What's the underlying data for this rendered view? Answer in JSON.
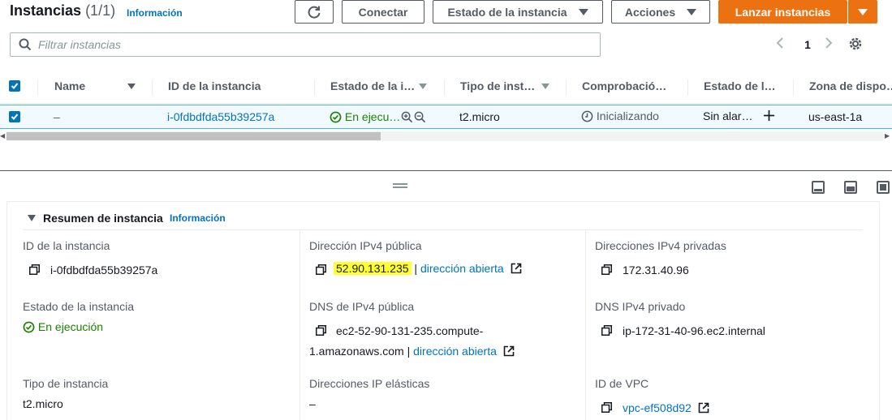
{
  "header": {
    "title": "Instancias",
    "count": "(1/1)",
    "info_link": "Información",
    "buttons": {
      "connect": "Conectar",
      "instance_state": "Estado de la instancia",
      "actions": "Acciones",
      "launch": "Lanzar instancias"
    }
  },
  "search": {
    "placeholder": "Filtrar instancias"
  },
  "pagination": {
    "current_page": "1"
  },
  "table": {
    "columns": [
      "Name",
      "ID de la instancia",
      "Estado de la i…",
      "Tipo de inst…",
      "Comprobació…",
      "Estado de l…",
      "Zona de dispo…"
    ],
    "row": {
      "name": "–",
      "instance_id": "i-0fdbdfda55b39257a",
      "state": "En ejecu…",
      "type": "t2.micro",
      "status_check": "Inicializando",
      "alarm_state": "Sin alar…",
      "zone": "us-east-1a"
    }
  },
  "details": {
    "section_title": "Resumen de instancia",
    "info_link": "Información",
    "fields": {
      "instance_id_label": "ID de la instancia",
      "instance_id_value": "i-0fdbdfda55b39257a",
      "public_ipv4_label": "Dirección IPv4 pública",
      "public_ipv4_value": "52.90.131.235",
      "open_address": "dirección abierta",
      "private_ipv4_label": "Direcciones IPv4 privadas",
      "private_ipv4_value": "172.31.40.96",
      "state_label": "Estado de la instancia",
      "state_value": "En ejecución",
      "public_dns_label": "DNS de IPv4 pública",
      "public_dns_line1": "ec2-52-90-131-235.compute-",
      "public_dns_line2": "1.amazonaws.com",
      "private_dns_label": "DNS IPv4 privado",
      "private_dns_value": "ip-172-31-40-96.ec2.internal",
      "type_label": "Tipo de instancia",
      "type_value": "t2.micro",
      "elastic_ip_label": "Direcciones IP elásticas",
      "elastic_ip_value": "–",
      "vpc_label": "ID de VPC",
      "vpc_value": "vpc-ef508d92"
    }
  },
  "colors": {
    "accent": "#0073bb",
    "primary_button": "#ec7211",
    "success": "#1d8102",
    "highlight": "#ffff33"
  }
}
